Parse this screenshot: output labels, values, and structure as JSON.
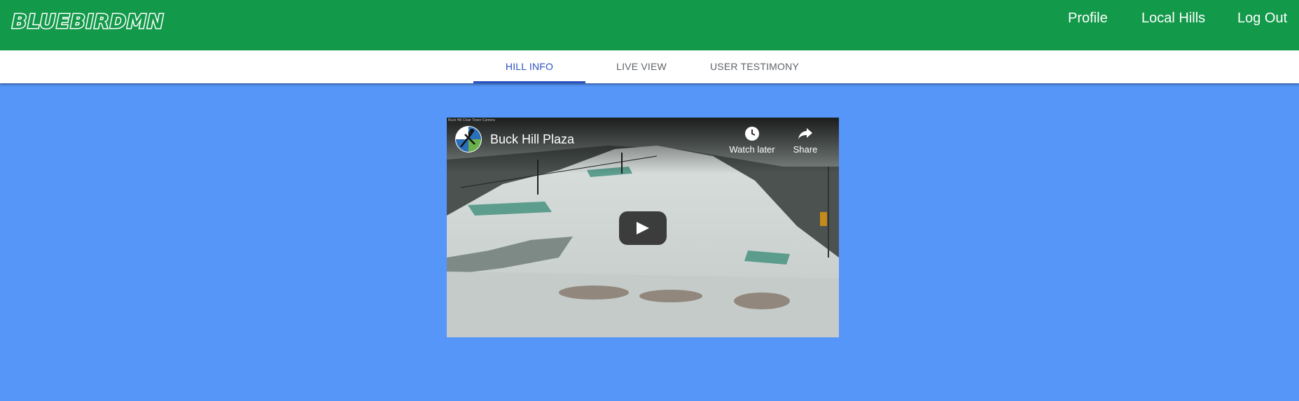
{
  "header": {
    "logo": "BLUEBIRDMN",
    "nav": {
      "profile": "Profile",
      "local_hills": "Local Hills",
      "log_out": "Log Out"
    }
  },
  "tabs": {
    "hill_info": "HILL INFO",
    "live_view": "LIVE VIEW",
    "user_testimony": "USER TESTIMONY",
    "active": "HILL INFO"
  },
  "video": {
    "caption": "Buck Hill Chair Tower Camera",
    "title": "Buck Hill Plaza",
    "watch_later": "Watch later",
    "share": "Share"
  },
  "colors": {
    "header_bg": "#13994a",
    "page_bg": "#5696f8",
    "tab_active": "#2a52be"
  }
}
